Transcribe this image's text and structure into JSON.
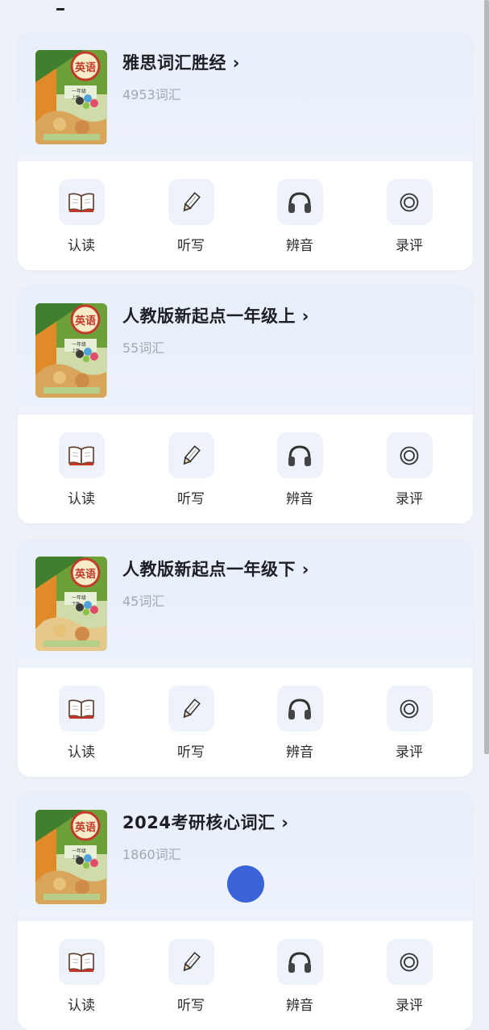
{
  "books": [
    {
      "title": "雅思词汇胜经 ›",
      "count": "4953词汇",
      "cover_variant": "a"
    },
    {
      "title": "人教版新起点一年级上 ›",
      "count": "55词汇",
      "cover_variant": "a"
    },
    {
      "title": "人教版新起点一年级下 ›",
      "count": "45词汇",
      "cover_variant": "b"
    },
    {
      "title": "2024考研核心词汇 ›",
      "count": "1860词汇",
      "cover_variant": "a"
    }
  ],
  "cover": {
    "subject": "英语",
    "grade_a": "一年级",
    "term_a": "上册",
    "grade_b": "一年级",
    "term_b": "下册"
  },
  "actions": [
    {
      "label": "认读",
      "icon": "open-book-icon"
    },
    {
      "label": "听写",
      "icon": "pencil-icon"
    },
    {
      "label": "辨音",
      "icon": "headphones-icon"
    },
    {
      "label": "录评",
      "icon": "record-icon"
    }
  ],
  "colors": {
    "page_bg": "#eef2f8",
    "card_head_bg": "#e8effb",
    "icon_bg": "#eef2fa",
    "fab": "#3a63d8"
  }
}
